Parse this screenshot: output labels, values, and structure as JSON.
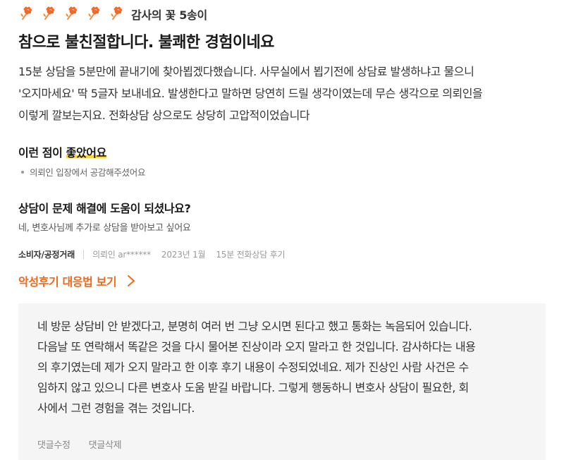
{
  "rating": {
    "flower_count": 5,
    "flower_color": "#f06a2c",
    "icon": "flower-icon",
    "label": "감사의 꽃 5송이"
  },
  "review": {
    "title": "참으로 불친절합니다. 불쾌한 경험이네요",
    "body_lines": [
      "15분 상담을 5분만에 끝내기에 찾아뵙겠다했습니다. 사무실에서 뵙기전에 상담료 발생하냐고 물으니",
      "'오지마세요' 딱 5글자 보내네요. 발생한다고 말하면 당연히 드릴 생각이였는데 무슨 생각으로 의뢰인을",
      "이렇게 깔보는지요. 전화상담 상으로도 상당히 고압적이었습니다"
    ]
  },
  "good_points": {
    "heading_prefix": "이런 점이 ",
    "heading_highlight": "좋았어요",
    "items": [
      "의뢰인 입장에서 공감해주셨어요"
    ]
  },
  "helpfulness": {
    "question": "상담이 문제 해결에 도움이 되셨나요?",
    "answer": "네, 변호사님께 추가로 상담을 받아보고 싶어요"
  },
  "meta": {
    "category": "소비자/공정거래",
    "client": "의뢰인 ar******",
    "date": "2023년 1월",
    "consult_type": "15분 전화상담 후기"
  },
  "bad_review_link": {
    "label": "악성후기 대응법 보기",
    "icon": "chevron-right-icon",
    "color": "#ee6a1c"
  },
  "reply": {
    "lines": [
      "네 방문 상담비 안 받겠다고, 분명히 여러 번 그냥 오시면 된다고 했고 통화는 녹음되어 있습니다.",
      "다음날 또 연락해서 똑같은 것을 다시 물어본 진상이라 오지 말라고 한 것입니다. 감사하다는 내용",
      "의 후기였는데 제가 오지 말라고 한 이후 후기 내용이 수정되었네요. 제가 진상인 사람 사건은 수",
      "임하지 않고 있으니 다른 변호사 도움 받길 바랍니다. 그렇게 행동하니 변호사 상담이 필요한, 회",
      "사에서 그런 경험을 겪는 것입니다."
    ],
    "edit_label": "댓글수정",
    "delete_label": "댓글삭제"
  },
  "colors": {
    "accent_orange": "#ee6a1c",
    "highlight_yellow": "#ffd43b",
    "reply_background": "#f5f5f5"
  }
}
